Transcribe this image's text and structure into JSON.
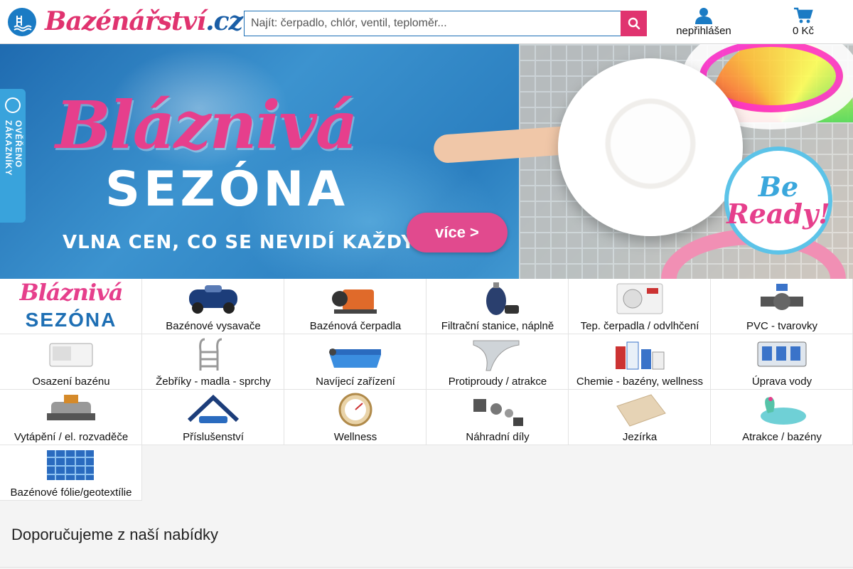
{
  "header": {
    "logo_text": "Bazénářství",
    "logo_domain": ".cz",
    "search_placeholder": "Najít: čerpadlo, chlór, ventil, teploměr...",
    "account_label": "nepřihlášen",
    "cart_label": "0 Kč"
  },
  "banner": {
    "title_line1": "Bláznivá",
    "title_line2": "SEZÓNA",
    "tagline": "VLNA CEN, CO SE NEVIDÍ KAŽDÝ DEN.",
    "cta_label": "více >",
    "badge_line1": "Be",
    "badge_line2": "Ready!"
  },
  "side_tab": {
    "label": "OVĚŘENO ZÁKAZNÍKY"
  },
  "promo_tile": {
    "line1": "Bláznivá",
    "line2": "SEZÓNA"
  },
  "categories": [
    {
      "label": "Bazénové vysavače",
      "icon": "pool-vacuum-icon"
    },
    {
      "label": "Bazénová čerpadla",
      "icon": "pool-pump-icon"
    },
    {
      "label": "Filtrační stanice, náplně",
      "icon": "filter-station-icon"
    },
    {
      "label": "Tep. čerpadla / odvlhčení",
      "icon": "heat-pump-icon"
    },
    {
      "label": "PVC - tvarovky",
      "icon": "pvc-valve-icon"
    },
    {
      "label": "Osazení bazénu",
      "icon": "skimmer-icon"
    },
    {
      "label": "Žebříky - madla - sprchy",
      "icon": "ladder-icon"
    },
    {
      "label": "Navíjecí zařízení",
      "icon": "cover-reel-icon"
    },
    {
      "label": "Protiproudy / atrakce",
      "icon": "waterfall-icon"
    },
    {
      "label": "Chemie - bazény, wellness",
      "icon": "chemicals-icon"
    },
    {
      "label": "Úprava vody",
      "icon": "water-treatment-icon"
    },
    {
      "label": "Vytápění / el. rozvaděče",
      "icon": "heater-icon"
    },
    {
      "label": "Příslušenství",
      "icon": "accessories-icon"
    },
    {
      "label": "Wellness",
      "icon": "thermometer-icon"
    },
    {
      "label": "Náhradní díly",
      "icon": "spare-parts-icon"
    },
    {
      "label": "Jezírka",
      "icon": "pond-icon"
    },
    {
      "label": "Atrakce / bazény",
      "icon": "inflatable-icon"
    },
    {
      "label": "Bazénové fólie/geotextílie",
      "icon": "pool-liner-icon"
    }
  ],
  "recommend": {
    "title": "Doporučujeme z naší nabídky"
  },
  "colors": {
    "brand_pink": "#e0336f",
    "brand_blue": "#1a7bc4"
  }
}
